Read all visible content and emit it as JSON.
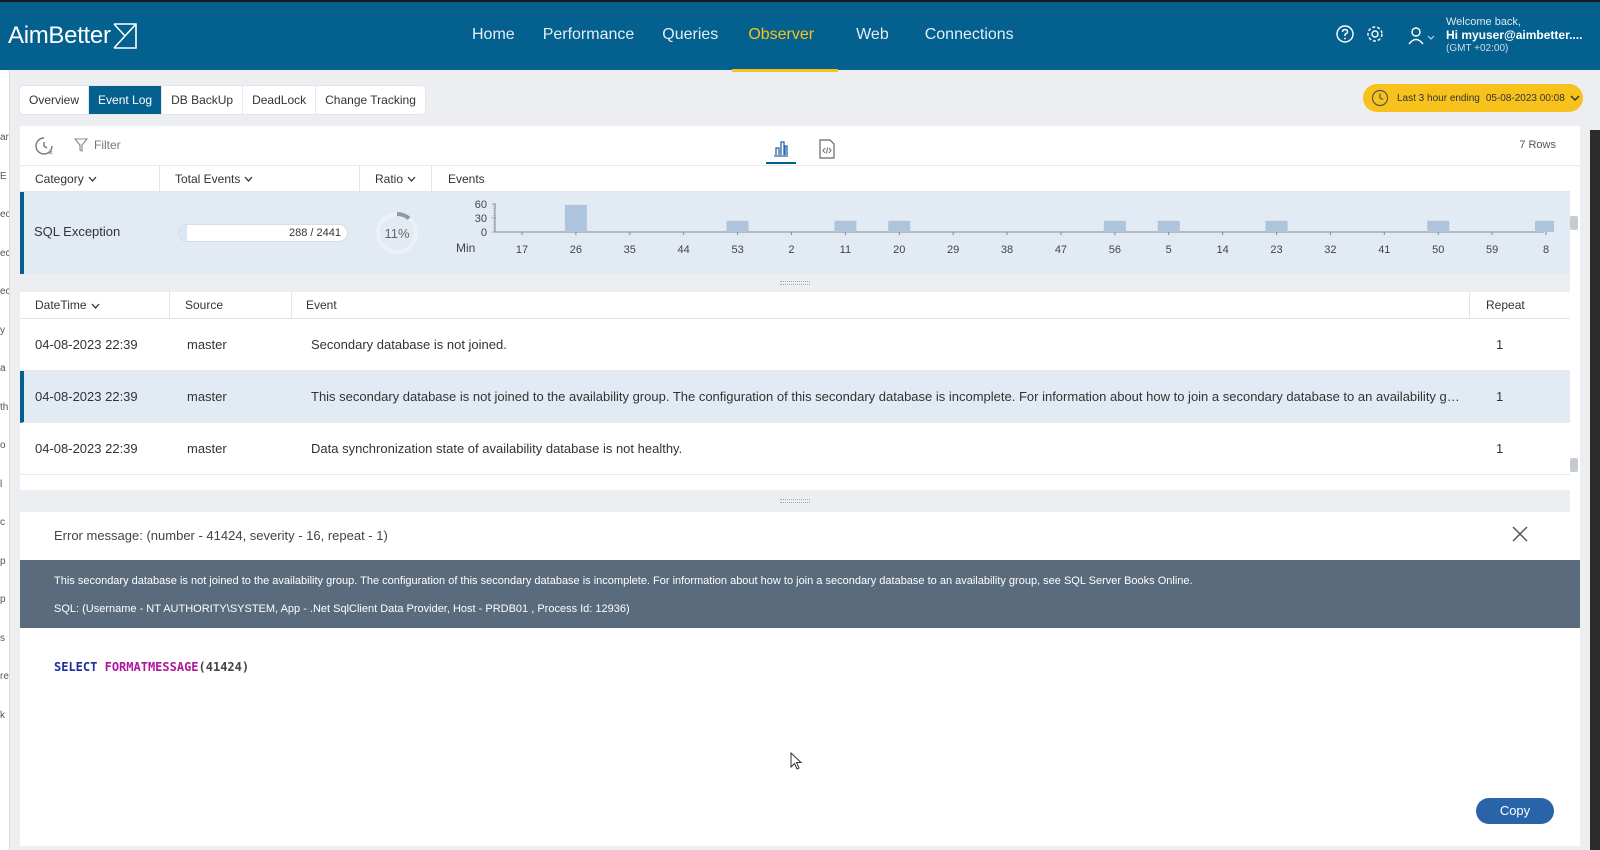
{
  "app": {
    "logo_text": "AimBetter"
  },
  "nav": {
    "items": [
      {
        "label": "Home"
      },
      {
        "label": "Performance"
      },
      {
        "label": "Queries"
      },
      {
        "label": "Observer",
        "active": true
      },
      {
        "label": "Web"
      },
      {
        "label": "Connections"
      }
    ]
  },
  "user": {
    "welcome": "Welcome back,",
    "name": "Hi myuser@aimbetter....",
    "timezone": "(GMT +02:00)"
  },
  "left_rail": [
    "ar",
    "E",
    "ec",
    "ec",
    "ec",
    "y",
    "a",
    "th",
    "o",
    "l",
    "c",
    "p",
    "p",
    "s",
    "re",
    "k"
  ],
  "tabs": [
    {
      "label": "Overview"
    },
    {
      "label": "Event Log",
      "active": true
    },
    {
      "label": "DB BackUp"
    },
    {
      "label": "DeadLock"
    },
    {
      "label": "Change Tracking"
    }
  ],
  "time_range": {
    "label": "Last 3 hour ending",
    "value": "05-08-2023 00:08"
  },
  "toolbar": {
    "filter_label": "Filter",
    "row_count": "7 Rows"
  },
  "summary": {
    "headers": {
      "category": "Category",
      "total_events": "Total Events",
      "ratio": "Ratio",
      "events": "Events"
    },
    "row": {
      "category": "SQL Exception",
      "total_text": "288 / 2441",
      "total": 288,
      "of": 2441,
      "ratio_text": "11%",
      "ratio": 0.11
    }
  },
  "chart_data": {
    "type": "bar",
    "xlabel": "Min",
    "ylim": [
      0,
      60
    ],
    "yticks": [
      "60",
      "30",
      "0"
    ],
    "tick_labels": [
      "17",
      "26",
      "35",
      "44",
      "53",
      "2",
      "11",
      "20",
      "29",
      "38",
      "47",
      "56",
      "5",
      "14",
      "23",
      "32",
      "41",
      "50",
      "59",
      "8"
    ],
    "bars": [
      {
        "tick_pos": 1,
        "value": 58
      },
      {
        "tick_pos": 4,
        "value": 24
      },
      {
        "tick_pos": 6,
        "value": 24
      },
      {
        "tick_pos": 7,
        "value": 24
      },
      {
        "tick_pos": 11,
        "value": 24
      },
      {
        "tick_pos": 12,
        "value": 24
      },
      {
        "tick_pos": 14,
        "value": 24
      },
      {
        "tick_pos": 17,
        "value": 24
      },
      {
        "tick_pos": 19,
        "value": 24
      }
    ],
    "color": "#aec4dc"
  },
  "grid": {
    "headers": {
      "datetime": "DateTime",
      "source": "Source",
      "event": "Event",
      "repeat": "Repeat"
    },
    "rows": [
      {
        "datetime": "04-08-2023 22:39",
        "source": "master",
        "event": "Secondary database is not joined.",
        "repeat": "1"
      },
      {
        "datetime": "04-08-2023 22:39",
        "source": "master",
        "event": "This secondary database is not joined to the availability group. The configuration of this secondary database is incomplete. For information about how to join a secondary database to an availability group, see SQL ...",
        "repeat": "1"
      },
      {
        "datetime": "04-08-2023 22:39",
        "source": "master",
        "event": "Data synchronization state of availability database is not healthy.",
        "repeat": "1"
      }
    ]
  },
  "detail": {
    "title": "Error message: (number - 41424, severity - 16, repeat - 1)",
    "message": "This secondary database is not joined to the availability group. The configuration of this secondary database is incomplete. For information about how to join a secondary database to an availability group, see SQL Server Books Online.",
    "sql_info": "SQL: (Username - NT AUTHORITY\\SYSTEM, App - .Net SqlClient Data Provider, Host - PRDB01 , Process Id: 12936)",
    "code": {
      "keyword": "SELECT",
      "function": "FORMATMESSAGE",
      "args": "(41424)"
    },
    "copy_label": "Copy"
  },
  "colors": {
    "brand": "#03608f",
    "accent": "#f8c21c",
    "detail_bg": "#5a6b7d"
  }
}
